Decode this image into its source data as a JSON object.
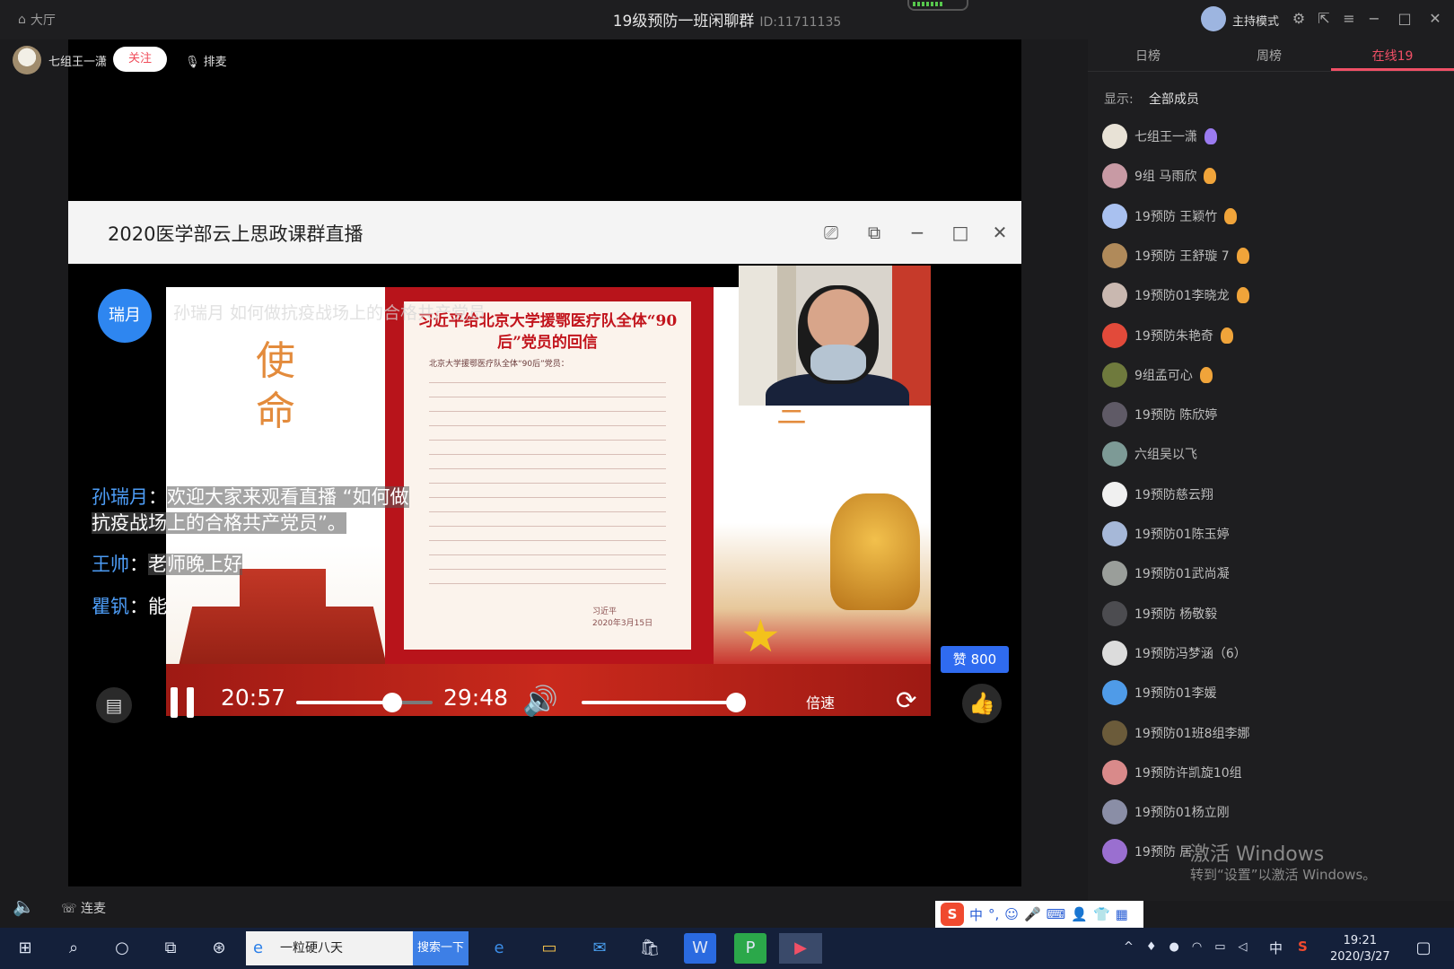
{
  "app": {
    "lobby_label": "大厅",
    "title": "19级预防一班闲聊群",
    "id_text": "ID:11711135",
    "host_mode_label": "主持模式"
  },
  "user_bar": {
    "name": "七组王一潇",
    "follow_label": "关注",
    "mic_queue_label": "排麦"
  },
  "live": {
    "title": "2020医学部云上思政课群直播",
    "speaker_badge": "瑞月",
    "slide": {
      "caption": "孙瑞月 如何做抗疫战场上的合格共产党员",
      "mission_text": "使命",
      "letter_heading": "习近平给北京大学援鄂医疗队全体“90后”党员的回信",
      "letter_greeting": "北京大学援鄂医疗队全体“90后”党员：",
      "letter_sign": "习近平",
      "letter_date": "2020年3月15日",
      "partial_glyph": "三"
    },
    "chats": [
      {
        "name": "孙瑞月",
        "text": "欢迎大家来观看直播 “如何做",
        "text2": "抗疫战场上的合格共产党员”。"
      },
      {
        "name": "王帅",
        "text": "老师晚上好"
      },
      {
        "name": "瞿钒",
        "text": "能"
      }
    ],
    "controls": {
      "current_time": "20:57",
      "total_time": "29:48",
      "progress": 0.706,
      "volume": 1.0,
      "speed_label": "倍速"
    },
    "like_count_label": "赞 800"
  },
  "side_panel": {
    "tabs": [
      {
        "label": "日榜",
        "active": false
      },
      {
        "label": "周榜",
        "active": false
      },
      {
        "label": "在线19",
        "active": true
      }
    ],
    "filter_label": "显示:",
    "filter_value": "全部成员",
    "members": [
      {
        "name": "七组王一潇",
        "medal": "purple",
        "color": "#e8e2d6"
      },
      {
        "name": "9组 马雨欣",
        "medal": "orange",
        "color": "#c89aa4"
      },
      {
        "name": "19预防 王颖竹",
        "medal": "orange",
        "color": "#a9c1f0"
      },
      {
        "name": "19预防 王舒璇 7",
        "medal": "orange",
        "color": "#b08a5a"
      },
      {
        "name": "19预防01李晓龙",
        "medal": "orange",
        "color": "#c9b8b0"
      },
      {
        "name": "19预防朱艳奇",
        "medal": "orange",
        "color": "#e24a3a"
      },
      {
        "name": "9组孟可心",
        "medal": "orange",
        "color": "#6f7a3d"
      },
      {
        "name": "19预防 陈欣婷",
        "medal": "none",
        "color": "#5f5a66"
      },
      {
        "name": "六组吴以飞",
        "medal": "none",
        "color": "#7d9a96"
      },
      {
        "name": "19预防慈云翔",
        "medal": "none",
        "color": "#f0f0f0"
      },
      {
        "name": "19预防01陈玉婷",
        "medal": "none",
        "color": "#a6b8d8"
      },
      {
        "name": "19预防01武尚凝",
        "medal": "none",
        "color": "#9a9e9a"
      },
      {
        "name": "19预防 杨敬毅",
        "medal": "none",
        "color": "#4c4c50"
      },
      {
        "name": "19预防冯梦涵（6）",
        "medal": "none",
        "color": "#dcdcdc"
      },
      {
        "name": "19预防01李媛",
        "medal": "none",
        "color": "#4f9be8"
      },
      {
        "name": "19预防01班8组李娜",
        "medal": "none",
        "color": "#6b5b3a"
      },
      {
        "name": "19预防许凯旋10组",
        "medal": "none",
        "color": "#d98a8a"
      },
      {
        "name": "19预防01杨立刚",
        "medal": "none",
        "color": "#8a8ea6"
      },
      {
        "name": "19预防 居",
        "medal": "none",
        "color": "#9a6fd0"
      }
    ],
    "watermark_line1": "激活 Windows",
    "watermark_line2": "转到“设置”以激活 Windows。"
  },
  "bottom_bar": {
    "link_label": "连麦"
  },
  "ime": {
    "logo": "S",
    "lang": "中"
  },
  "taskbar": {
    "search_text": "一粒硬八天",
    "search_button": "搜索一下",
    "ime_lang": "中",
    "time": "19:21",
    "date": "2020/3/27"
  },
  "colors": {
    "accent": "#f05066",
    "brand_blue": "#2f6bf0",
    "chat_name": "#4d9cf5"
  }
}
